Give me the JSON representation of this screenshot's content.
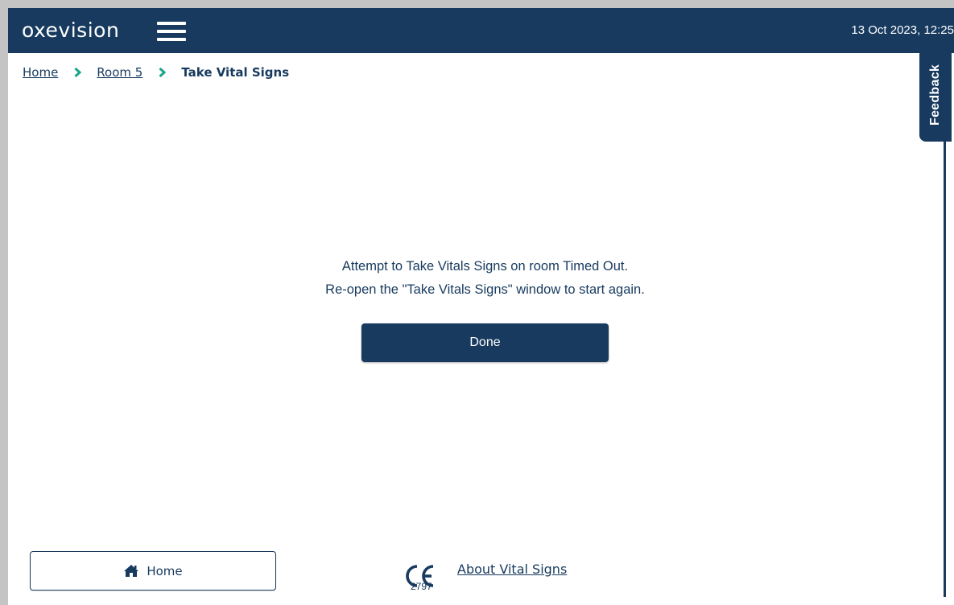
{
  "header": {
    "logo_text": "oxevision",
    "datetime": "13 Oct 2023, 12:25",
    "menu_icon": "hamburger-menu-icon"
  },
  "breadcrumb": {
    "items": [
      {
        "label": "Home"
      },
      {
        "label": "Room 5"
      }
    ],
    "current": "Take Vital Signs",
    "separator_icon": "chevron-right-icon",
    "separator_color": "#1aa58a"
  },
  "feedback": {
    "label": "Feedback"
  },
  "message": {
    "line1": "Attempt to Take Vitals Signs on room Timed Out.",
    "line2": "Re-open the \"Take Vitals Signs\" window to start again."
  },
  "done_button": {
    "label": "Done"
  },
  "footer": {
    "home_button_label": "Home",
    "home_icon": "home-icon",
    "ce_mark": "CE",
    "ce_number": "2797",
    "about_link": "About Vital Signs"
  },
  "colors": {
    "primary": "#173a5e",
    "accent": "#1aa58a",
    "background": "#ffffff",
    "frame": "#c4c4c4"
  }
}
